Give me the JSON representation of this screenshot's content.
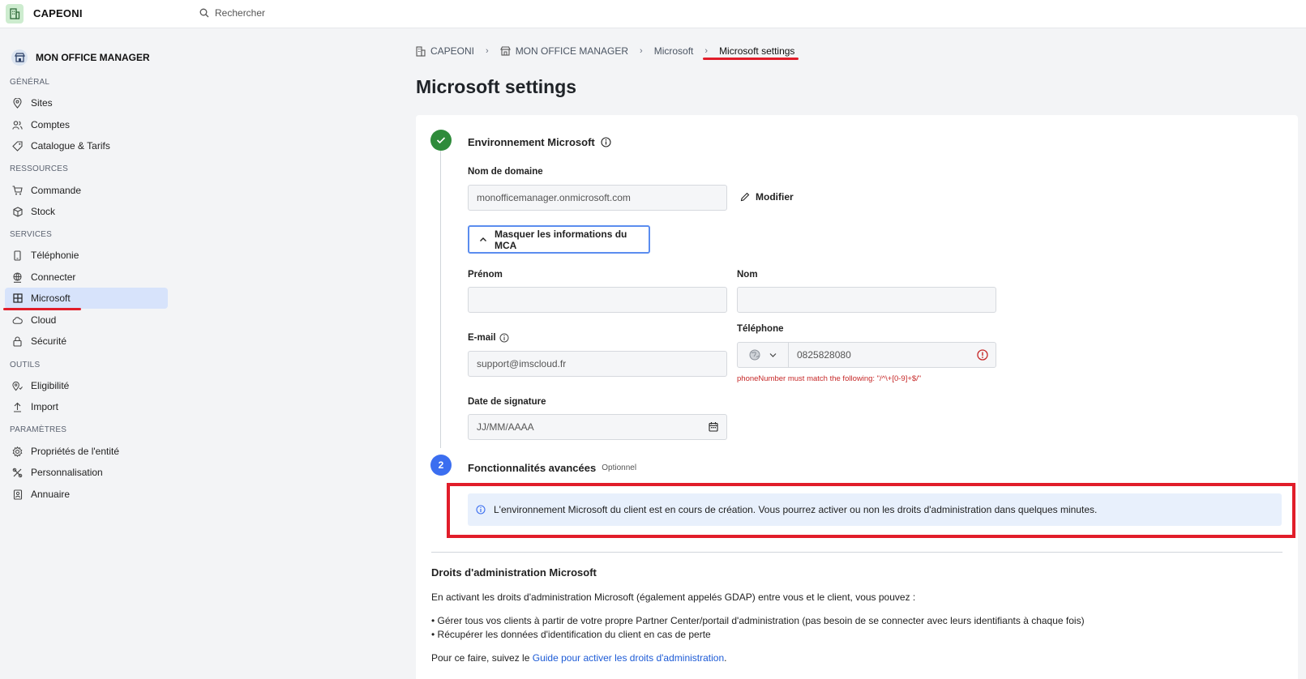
{
  "topbar": {
    "app_name": "CAPEONI",
    "search_placeholder": "Rechercher"
  },
  "sidebar": {
    "org_name": "MON OFFICE MANAGER",
    "sections": {
      "general": "GÉNÉRAL",
      "ressources": "RESSOURCES",
      "services": "SERVICES",
      "outils": "OUTILS",
      "parametres": "PARAMÈTRES"
    },
    "items": {
      "sites": "Sites",
      "comptes": "Comptes",
      "catalogue": "Catalogue & Tarifs",
      "commande": "Commande",
      "stock": "Stock",
      "telephonie": "Téléphonie",
      "connecter": "Connecter",
      "microsoft": "Microsoft",
      "cloud": "Cloud",
      "securite": "Sécurité",
      "eligibilite": "Eligibilité",
      "import": "Import",
      "proprietes": "Propriétés de l'entité",
      "personnalisation": "Personnalisation",
      "annuaire": "Annuaire"
    },
    "active_item": "microsoft"
  },
  "breadcrumb": [
    "CAPEONI",
    "MON OFFICE MANAGER",
    "Microsoft",
    "Microsoft settings"
  ],
  "page_title": "Microsoft settings",
  "step1": {
    "title": "Environnement Microsoft",
    "domain_label": "Nom de domaine",
    "domain_value": "monofficemanager.onmicrosoft.com",
    "modify_label": "Modifier",
    "mca_toggle_label": "Masquer les informations du MCA",
    "firstname_label": "Prénom",
    "firstname_value": "",
    "lastname_label": "Nom",
    "lastname_value": "",
    "email_label": "E-mail",
    "email_value": "support@imscloud.fr",
    "phone_label": "Téléphone",
    "phone_value": "0825828080",
    "phone_error": "phoneNumber must match the following: \"/^\\+[0-9]+$/\"",
    "date_label": "Date de signature",
    "date_placeholder": "JJ/MM/AAAA"
  },
  "step2": {
    "number": "2",
    "title": "Fonctionnalités avancées",
    "optional": "Optionnel",
    "info": "L'environnement Microsoft du client est en cours de création. Vous pourrez activer ou non les droits d'administration dans quelques minutes."
  },
  "admin": {
    "title": "Droits d'administration Microsoft",
    "intro": "En activant les droits d'administration Microsoft (également appelés GDAP) entre vous et le client, vous pouvez :",
    "bullet1": "• Gérer tous vos clients à partir de votre propre Partner Center/portail d'administration (pas besoin de se connecter avec leurs identifiants à chaque fois)",
    "bullet2": "• Récupérer les données d'identification du client en cas de perte",
    "outro_prefix": "Pour ce faire, suivez le ",
    "outro_link": "Guide pour activer les droits d'administration",
    "outro_suffix": "."
  },
  "colors": {
    "accent": "#5b8def",
    "success": "#2e8b3a",
    "step_blue": "#3b6ef0",
    "error": "#c62828",
    "annotation_red": "#e11d2a",
    "active_nav_bg": "#d7e3fb",
    "info_bg": "#e8f0fc"
  }
}
